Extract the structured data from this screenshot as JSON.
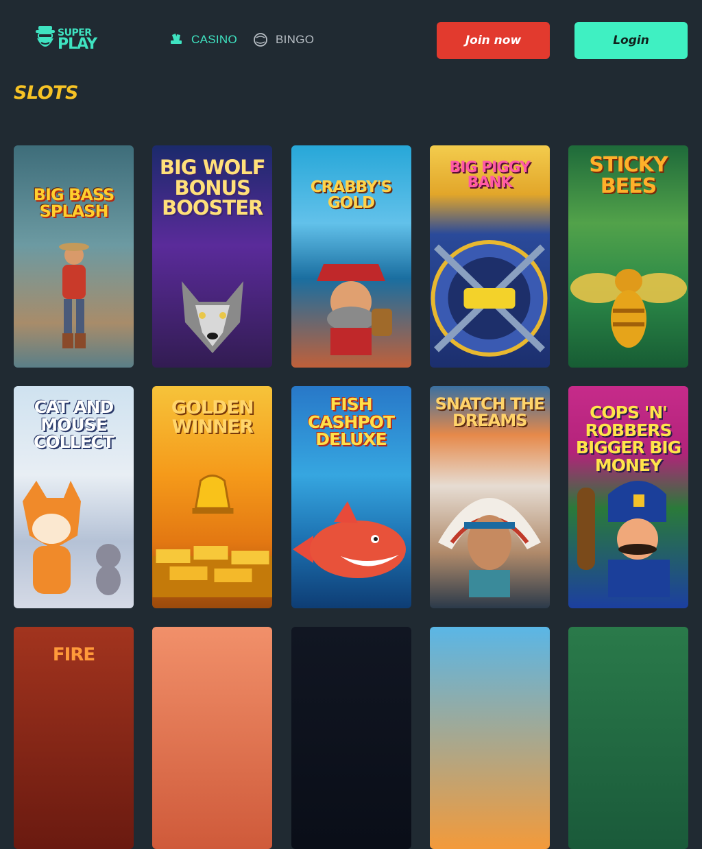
{
  "header": {
    "logo_super": "SUPER",
    "logo_play": "PLAY",
    "nav": [
      {
        "label": "CASINO",
        "icon": "cards-icon",
        "active": true
      },
      {
        "label": "BINGO",
        "icon": "bingo-ball-icon",
        "active": false
      }
    ],
    "join_label": "Join now",
    "login_label": "Login"
  },
  "section": {
    "title": "SLOTS"
  },
  "games": [
    {
      "title": "Big Bass Splash"
    },
    {
      "title": "Big Wolf Bonus Booster"
    },
    {
      "title": "Crabby's Gold"
    },
    {
      "title": "Big Piggy Bank"
    },
    {
      "title": "Sticky Bees"
    },
    {
      "title": "Cat and Mouse Collect"
    },
    {
      "title": "Golden Winner"
    },
    {
      "title": "Fish Cashpot Deluxe"
    },
    {
      "title": "Snatch the Dreams"
    },
    {
      "title": "Cops 'n' Robbers Bigger Big Money"
    },
    {
      "title": "Fire"
    },
    {
      "title": ""
    },
    {
      "title": ""
    },
    {
      "title": ""
    },
    {
      "title": ""
    }
  ],
  "colors": {
    "background": "#202a32",
    "accent": "#3fe3c1",
    "join": "#e23a2e",
    "login": "#3ff0c2",
    "section_title": "#f7c325"
  }
}
